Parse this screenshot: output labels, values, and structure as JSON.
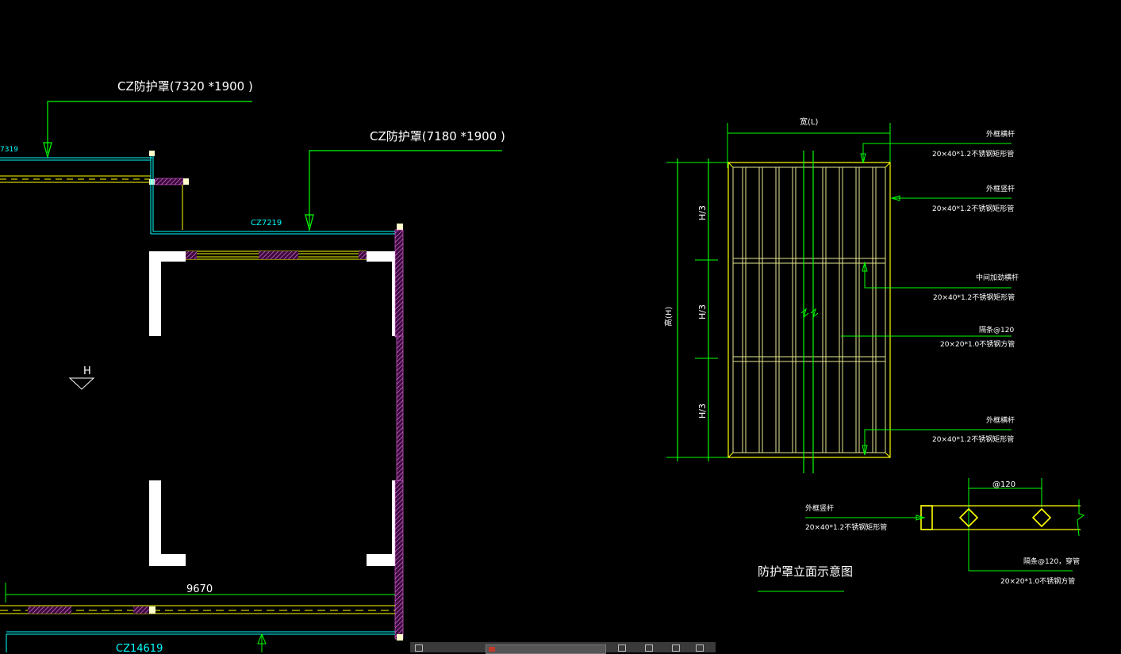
{
  "colors": {
    "background": "#000000",
    "dimension_green": "#00ff00",
    "frame_yellow": "#ffff00",
    "pale_yellow": "#e8e890",
    "cyan": "#00ffff",
    "wall_white": "#ffffff",
    "hatch_magenta": "#ff77ff"
  },
  "plan": {
    "leader_top": "CZ防护罩(7320 *1900 )",
    "leader_mid": "CZ防护罩(7180 *1900 )",
    "window_left": "7319",
    "window_mid": "CZ7219",
    "window_bottom": "CZ14619",
    "dimension_bottom": "9670",
    "level_mark": "H"
  },
  "elevation": {
    "width_label": "宽(L)",
    "height_label": "高(H)",
    "third_labels": [
      "H/3",
      "H/3",
      "H/3"
    ],
    "callouts": [
      {
        "name": "外框横杆",
        "spec": "20×40*1.2不锈钢矩形管"
      },
      {
        "name": "外框竖杆",
        "spec": "20×40*1.2不锈钢矩形管"
      },
      {
        "name": "中间加劲横杆",
        "spec": "20×40*1.2不锈钢矩形管"
      },
      {
        "name": "隔条@120",
        "spec": "20×20*1.0不锈钢方管"
      },
      {
        "name": "外框横杆",
        "spec": "20×40*1.2不锈钢矩形管"
      }
    ]
  },
  "section": {
    "spacing_label": "@120",
    "left_name": "外框竖杆",
    "left_spec": "20×40*1.2不锈钢矩形管",
    "right_name": "隔条@120，穿管",
    "right_spec": "20×20*1.0不锈钢方管"
  },
  "drawing_title": "防护罩立面示意图",
  "taskbar": {
    "item_label": ""
  }
}
